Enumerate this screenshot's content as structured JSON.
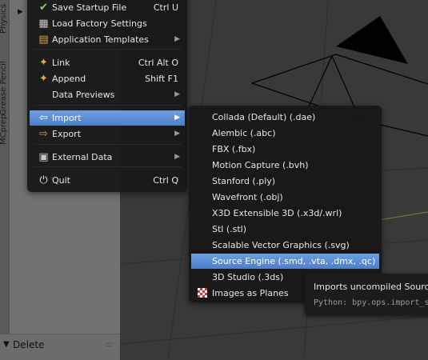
{
  "side_tabs": [
    "Physics",
    "Grease Pencil",
    "MCprep"
  ],
  "file_menu": {
    "items": [
      {
        "label": "Save Startup File",
        "shortcut": "Ctrl U",
        "icon": "save-startup-icon"
      },
      {
        "label": "Load Factory Settings",
        "shortcut": "",
        "icon": "load-factory-icon"
      },
      {
        "label": "Application Templates",
        "shortcut": "",
        "icon": "templates-icon"
      },
      {
        "label": "Link",
        "shortcut": "Ctrl Alt O",
        "icon": "link-icon"
      },
      {
        "label": "Append",
        "shortcut": "Shift F1",
        "icon": "append-icon"
      },
      {
        "label": "Data Previews",
        "shortcut": "",
        "icon": ""
      },
      {
        "label": "Import",
        "shortcut": "",
        "icon": "import-icon"
      },
      {
        "label": "Export",
        "shortcut": "",
        "icon": "export-icon"
      },
      {
        "label": "External Data",
        "shortcut": "",
        "icon": "external-data-icon"
      },
      {
        "label": "Quit",
        "shortcut": "Ctrl Q",
        "icon": "power-icon"
      }
    ]
  },
  "import_menu": {
    "items": [
      {
        "label": "Collada (Default) (.dae)"
      },
      {
        "label": "Alembic (.abc)"
      },
      {
        "label": "FBX (.fbx)"
      },
      {
        "label": "Motion Capture (.bvh)"
      },
      {
        "label": "Stanford (.ply)"
      },
      {
        "label": "Wavefront (.obj)"
      },
      {
        "label": "X3D Extensible 3D (.x3d/.wrl)"
      },
      {
        "label": "Stl (.stl)"
      },
      {
        "label": "Scalable Vector Graphics (.svg)"
      },
      {
        "label": "Source Engine (.smd, .vta, .dmx, .qc)"
      },
      {
        "label": "3D Studio (.3ds)"
      },
      {
        "label": "Images as Planes"
      }
    ]
  },
  "tooltip": {
    "description": "Imports uncompiled Source E",
    "python": "Python: bpy.ops.import_s"
  },
  "bottom_panel": {
    "label": "Delete"
  },
  "colors": {
    "highlight": "#5b8dd6",
    "menu_bg": "#171717",
    "viewport_bg": "#393939",
    "side_panel": "#727272"
  }
}
